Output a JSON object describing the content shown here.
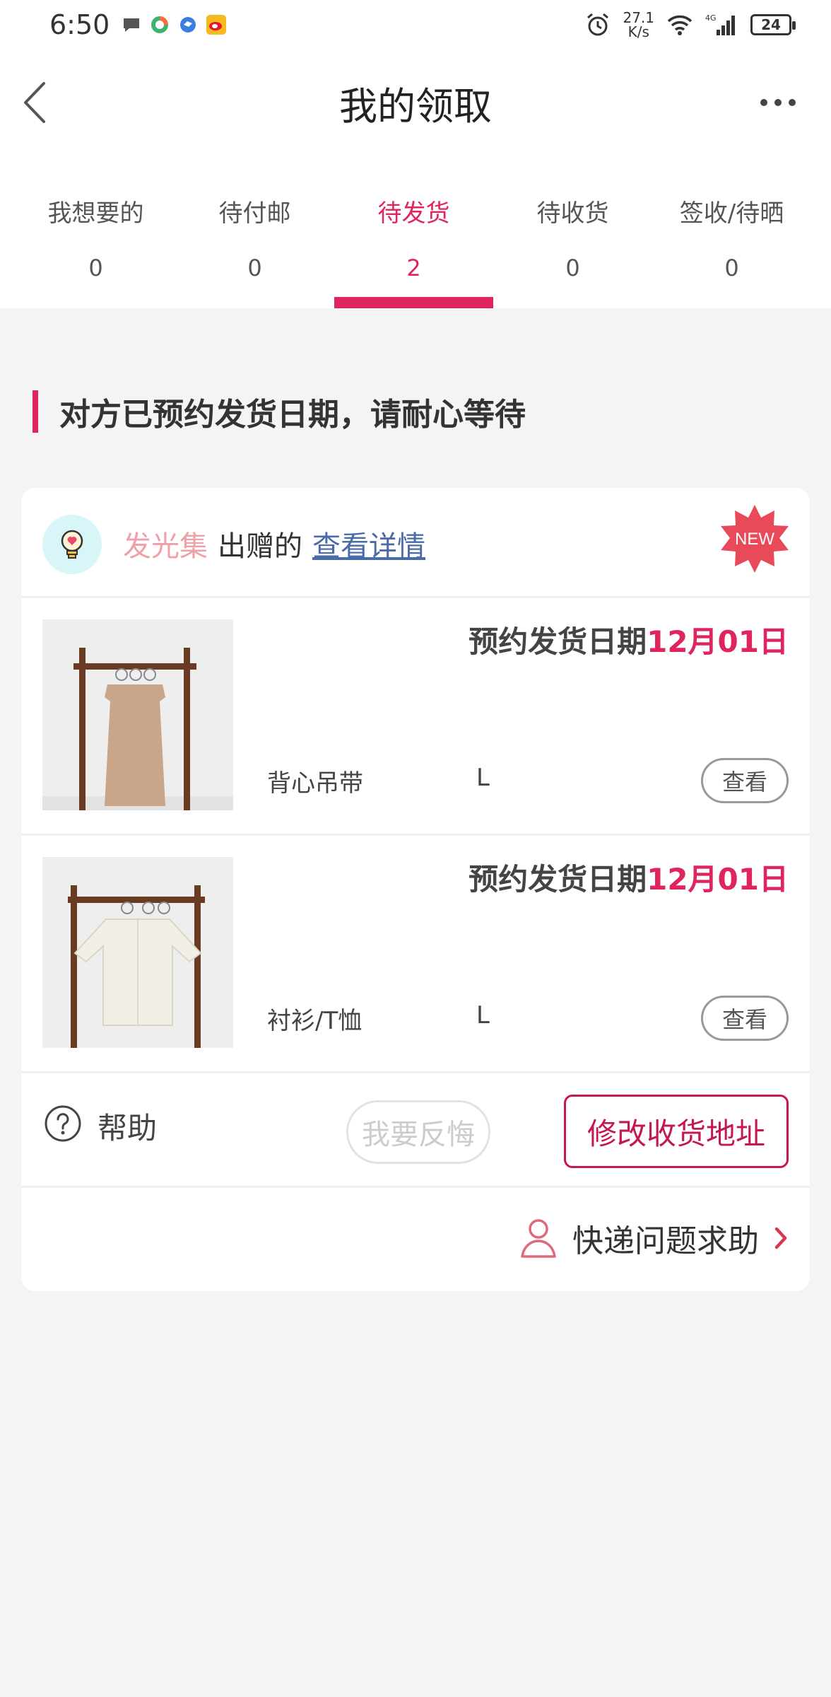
{
  "status_bar": {
    "time": "6:50",
    "net_speed_value": "27.1",
    "net_speed_unit": "K/s",
    "network": "4G",
    "battery": "24"
  },
  "header": {
    "title": "我的领取",
    "back_icon": "chevron-left-icon",
    "more_icon": "more-horizontal-icon"
  },
  "tabs": [
    {
      "label": "我想要的",
      "count": "0"
    },
    {
      "label": "待付邮",
      "count": "0"
    },
    {
      "label": "待发货",
      "count": "2",
      "active": true
    },
    {
      "label": "待收货",
      "count": "0"
    },
    {
      "label": "签收/待晒",
      "count": "0"
    }
  ],
  "notice": "对方已预约发货日期，请耐心等待",
  "card": {
    "giver_name": "发光集",
    "giver_suffix": "出赠的",
    "detail_link": "查看详情",
    "badge": "NEW",
    "items": [
      {
        "ship_label": "预约发货日期",
        "ship_date": "12月01日",
        "name": "背心吊带",
        "size": "L",
        "view": "查看"
      },
      {
        "ship_label": "预约发货日期",
        "ship_date": "12月01日",
        "name": "衬衫/T恤",
        "size": "L",
        "view": "查看"
      }
    ],
    "help": "帮助",
    "regret_button": "我要反悔",
    "change_address_button": "修改收货地址",
    "express_help": "快递问题求助"
  },
  "colors": {
    "accent": "#e0245e",
    "link": "#4a6aa8",
    "background": "#f4f4f4"
  }
}
